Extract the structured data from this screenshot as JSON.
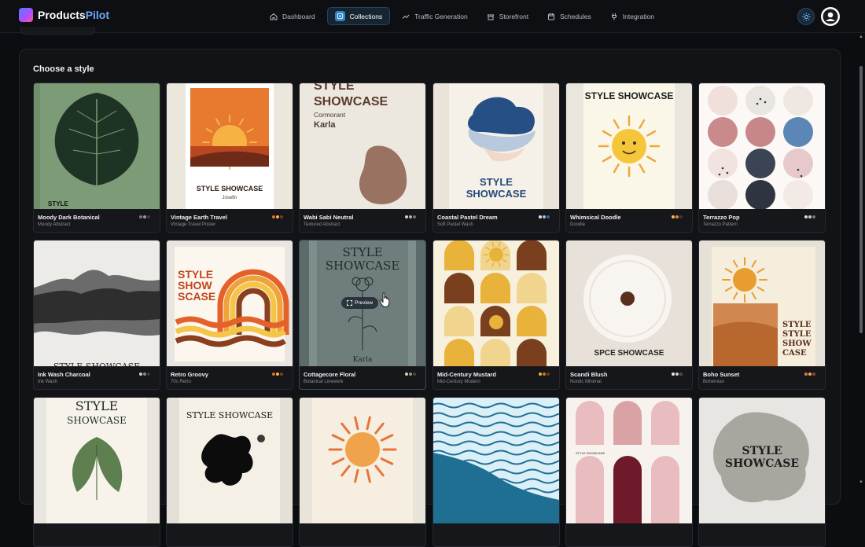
{
  "app": {
    "brand_part1": "Products",
    "brand_part2": "Pilot",
    "accent": "#2a86c7"
  },
  "nav": {
    "items": [
      {
        "label": "Dashboard",
        "icon": "home-icon"
      },
      {
        "label": "Collections",
        "icon": "collections-icon",
        "active": true
      },
      {
        "label": "Traffic Generation",
        "icon": "trend-icon"
      },
      {
        "label": "Storefront",
        "icon": "store-icon"
      },
      {
        "label": "Schedules",
        "icon": "calendar-icon"
      },
      {
        "label": "Integration",
        "icon": "plug-icon"
      }
    ]
  },
  "panel": {
    "title": "Choose a style"
  },
  "preview_label": "Preview",
  "styles": [
    {
      "name": "Moody Dark Botanical",
      "sub": "Moody Abstract",
      "swatches": [
        "#7a7a7a",
        "#9a9a9a",
        "#3a3a3a"
      ],
      "art": {
        "t1": "STYLE"
      }
    },
    {
      "name": "Vintage Earth Travel",
      "sub": "Vintage Travel Poster",
      "swatches": [
        "#e0722c",
        "#f2b04a",
        "#7a3a1e"
      ],
      "art": {
        "t1": "STYLE SHOWCASE",
        "t2": "Josefin"
      }
    },
    {
      "name": "Wabi Sabi Neutral",
      "sub": "Textured Abstract",
      "swatches": [
        "#d8d4cc",
        "#b9b2a6",
        "#7a6e60"
      ],
      "art": {
        "t1": "STYLE",
        "t2": "SHOWCASE",
        "t3": "Cormorant",
        "t4": "Karla"
      }
    },
    {
      "name": "Coastal Pastel Dream",
      "sub": "Soft Pastel Wash",
      "swatches": [
        "#dfe8f0",
        "#aac3dc",
        "#44628c"
      ],
      "art": {
        "t1": "STYLE",
        "t2": "SHOWCASE"
      }
    },
    {
      "name": "Whimsical Doodle",
      "sub": "Doodle",
      "swatches": [
        "#f4c542",
        "#e88a3a",
        "#3a3a3a"
      ],
      "art": {
        "t1": "STYLE SHOWCASE"
      }
    },
    {
      "name": "Terrazzo Pop",
      "sub": "Terrazzo Pattern",
      "swatches": [
        "#e6dede",
        "#c9c9c9",
        "#6a7a8a"
      ],
      "art": {}
    },
    {
      "name": "Ink Wash Charcoal",
      "sub": "Ink Wash",
      "swatches": [
        "#cfcfcf",
        "#8a8a8a",
        "#3a3a3a"
      ],
      "art": {
        "t1": "STYLE SHOWCASE"
      }
    },
    {
      "name": "Retro Groovy",
      "sub": "70s Retro",
      "swatches": [
        "#e86a2a",
        "#f2b83a",
        "#8a3a1e"
      ],
      "art": {
        "t1": "STYLE",
        "t2": "SHOW",
        "t3": "SCASE"
      }
    },
    {
      "name": "Cottagecore Floral",
      "sub": "Botanical Linework",
      "swatches": [
        "#c9d4b0",
        "#8aa070",
        "#3a4a3a"
      ],
      "art": {
        "t1": "STYLE",
        "t2": "SHOWCASE",
        "t3": "Karla"
      }
    },
    {
      "name": "Mid-Century Mustard",
      "sub": "Mid-Century Modern",
      "swatches": [
        "#e9b23a",
        "#c97a2a",
        "#6a3a1e"
      ],
      "art": {}
    },
    {
      "name": "Scandi Blush",
      "sub": "Nordic Minimal",
      "swatches": [
        "#f0e6e0",
        "#d9c9c0",
        "#5a4a40"
      ],
      "art": {
        "t1": "SPCE SHOWCASE"
      }
    },
    {
      "name": "Boho Sunset",
      "sub": "Bohemian",
      "swatches": [
        "#e07a3a",
        "#f2a85a",
        "#8a4a2a"
      ],
      "art": {
        "t1": "STYLE",
        "t2": "STYLE",
        "t3": "SHOW",
        "t4": "CASE"
      }
    },
    {
      "name": "",
      "sub": "",
      "swatches": [],
      "art": {
        "t1": "STYLE",
        "t2": "SHOWCASE"
      }
    },
    {
      "name": "",
      "sub": "",
      "swatches": [],
      "art": {
        "t1": "STYLE SHOWCASE"
      }
    },
    {
      "name": "",
      "sub": "",
      "swatches": [],
      "art": {}
    },
    {
      "name": "",
      "sub": "",
      "swatches": [],
      "art": {}
    },
    {
      "name": "",
      "sub": "",
      "swatches": [],
      "art": {
        "t1": "STYLE SHOWCASE"
      }
    },
    {
      "name": "",
      "sub": "",
      "swatches": [],
      "art": {
        "t1": "STYLE",
        "t2": "SHOWCASE"
      }
    }
  ]
}
